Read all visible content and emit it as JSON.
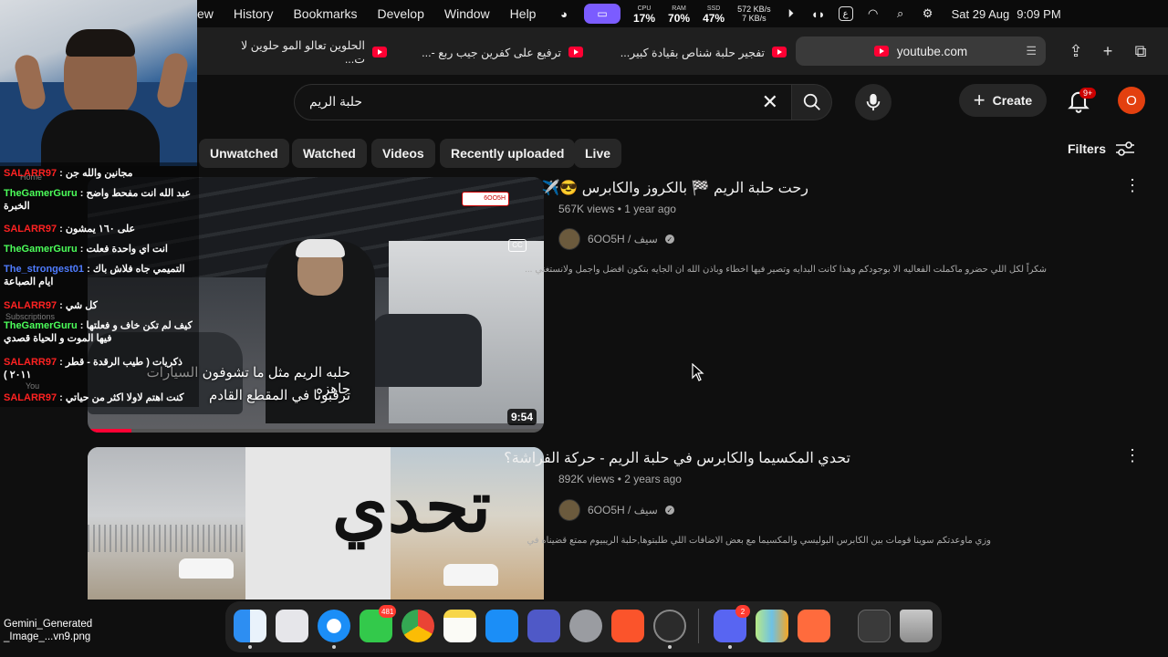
{
  "menubar": {
    "items": [
      "ew",
      "History",
      "Bookmarks",
      "Develop",
      "Window",
      "Help"
    ],
    "cpu_label": "CPU",
    "cpu_value": "17%",
    "ram_label": "RAM",
    "ram_value": "70%",
    "ssd_label": "SSD",
    "ssd_value": "47%",
    "net_up": "572 KB/s",
    "net_down": "7 KB/s",
    "date": "Sat 29 Aug",
    "time": "9:09 PM"
  },
  "tabs": [
    "الحلوين تعالو المو حلوين لا ت...",
    "ترفيع على كفرين جيب ربع -...",
    "تفجير حلبة شناص بقيادة كبير..."
  ],
  "address": {
    "url": "youtube.com"
  },
  "search": {
    "query": "حلبة الريم"
  },
  "header": {
    "create_label": "Create",
    "notif_count": "9+",
    "avatar_letter": "O"
  },
  "chips": [
    "Unwatched",
    "Watched",
    "Videos",
    "Recently uploaded",
    "Live"
  ],
  "filters_label": "Filters",
  "videos": [
    {
      "title": "رحت حلبة الريم 🏁 بالكروز والكابرس 😎✈️",
      "views": "567K views",
      "age": "1 year ago",
      "channel": "6OO5H / سيف",
      "description": "شكراً لكل اللي حضرو ماكملت الفعاليه الا بوجودكم وهذا كانت البدايه وتصير فيها اخطاء وباذن الله ان الجايه بتكون افضل واجمل ولانستغني ...",
      "duration": "9:54",
      "thumb_caption_1": "حلبه الريم مثل ما تشوفون السيارات جاهزه",
      "thumb_caption_2": "ترقبونا في المقطع القادم",
      "thumb_cc": "CC",
      "thumb_logo": "6OO5H"
    },
    {
      "title": "تحدي المكسيما والكابرس في حلبة الريم - حركة الفراشة؟",
      "views": "892K views",
      "age": "2 years ago",
      "channel": "6OO5H / سيف",
      "description": "وزي ماوعدتكم سوينا قومات بين الكابرس البوليسي والمكسيما مع بعض الاضافات اللي طلبتوها,حلبة الريبيوم ممتع قضيناه في",
      "thumb_text": "تحدي"
    }
  ],
  "chat": [
    {
      "name": "SALARR97",
      "msg": "مجانين والله جن",
      "color": "red"
    },
    {
      "name": "TheGamerGuru",
      "msg": "عبد الله انت مفحط واضح الخبرة",
      "color": "green"
    },
    {
      "name": "SALARR97",
      "msg": "على ١٦٠ يمشون",
      "color": "red"
    },
    {
      "name": "TheGamerGuru",
      "msg": "انت اي واحدة فعلت",
      "color": "green"
    },
    {
      "name": "The_strongest01",
      "msg": "التميمي جاه فلاش باك ايام الصباعة",
      "color": "blue"
    },
    {
      "name": "SALARR97",
      "msg": "كل شي",
      "color": "red"
    },
    {
      "name": "TheGamerGuru",
      "msg": "كيف لم تكن خاف و فعلتها فيها الموت و الحياة قصدي",
      "color": "green"
    },
    {
      "name": "SALARR97",
      "msg": "ذكريات ( طيب الرقدة - قطر ٢٠١١ )",
      "color": "red"
    },
    {
      "name": "SALARR97",
      "msg": "كنت اهتم لاولا اكثر من حياتي",
      "color": "red"
    }
  ],
  "sidebar_ghost": {
    "home": "Home",
    "subscriptions": "Subscriptions",
    "you": "You"
  },
  "dock": {
    "messages_badge": "481",
    "discord_badge": "2"
  },
  "desktop_file": {
    "line1": "Gemini_Generated",
    "line2": "_Image_...vn9.png"
  }
}
